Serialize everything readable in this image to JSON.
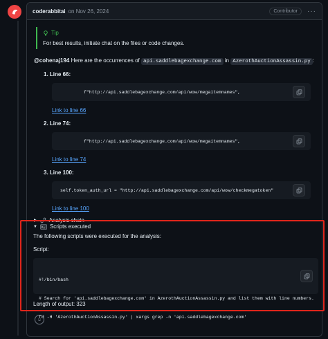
{
  "comment": {
    "author": "coderabbitai",
    "date": "on Nov 26, 2024",
    "role": "Contributor",
    "kebab": "···"
  },
  "tip": {
    "title": "Tip",
    "text": "For best results, initiate chat on the files or code changes."
  },
  "intro": {
    "mention": "@cohenaj194",
    "text1": " Here are the occurrences of ",
    "code1": "api.saddlebagexchange.com",
    "text2": " in ",
    "code2": "AzerothAuctionAssassin.py",
    "text3": ":"
  },
  "items": [
    {
      "title": "1.  Line 66:",
      "code": "f\"http://api.saddlebagexchange.com/api/wow/megaitemnames\",",
      "link": "Link to line 66"
    },
    {
      "title": "2.  Line 74:",
      "code": "f\"http://api.saddlebagexchange.com/api/wow/megaitemnames\",",
      "link": "Link to line 74"
    },
    {
      "title": "3.  Line 100:",
      "code": "self.token_auth_url = \"http://api.saddlebagexchange.com/api/wow/checkmegatoken\"",
      "link": "Link to line 100"
    }
  ],
  "analysis_chain": "Analysis chain",
  "scripts": {
    "summary": "Scripts executed",
    "description": "The following scripts were executed for the analysis:",
    "label": "Script:",
    "lines": [
      "#!/bin/bash",
      "# Search for 'api.saddlebagexchange.com' in AzerothAuctionAssassin.py and list them with line numbers.",
      "fd -H 'AzerothAuctionAssassin.py' | xargs grep -n 'api.saddlebagexchange.com'"
    ],
    "output_length": "Length of output: 323"
  },
  "icons": {
    "avatar": "coderabbit-avatar-icon",
    "tip": "lightbulb-icon",
    "copy": "copy-icon",
    "chain": "link-icon",
    "scripts": "terminal-icon",
    "smiley": "smiley-icon"
  },
  "colors": {
    "background": "#0d1117",
    "link": "#58a6ff",
    "tip": "#3fb950",
    "highlight": "#e1251b",
    "avatar": "#ef4444"
  }
}
